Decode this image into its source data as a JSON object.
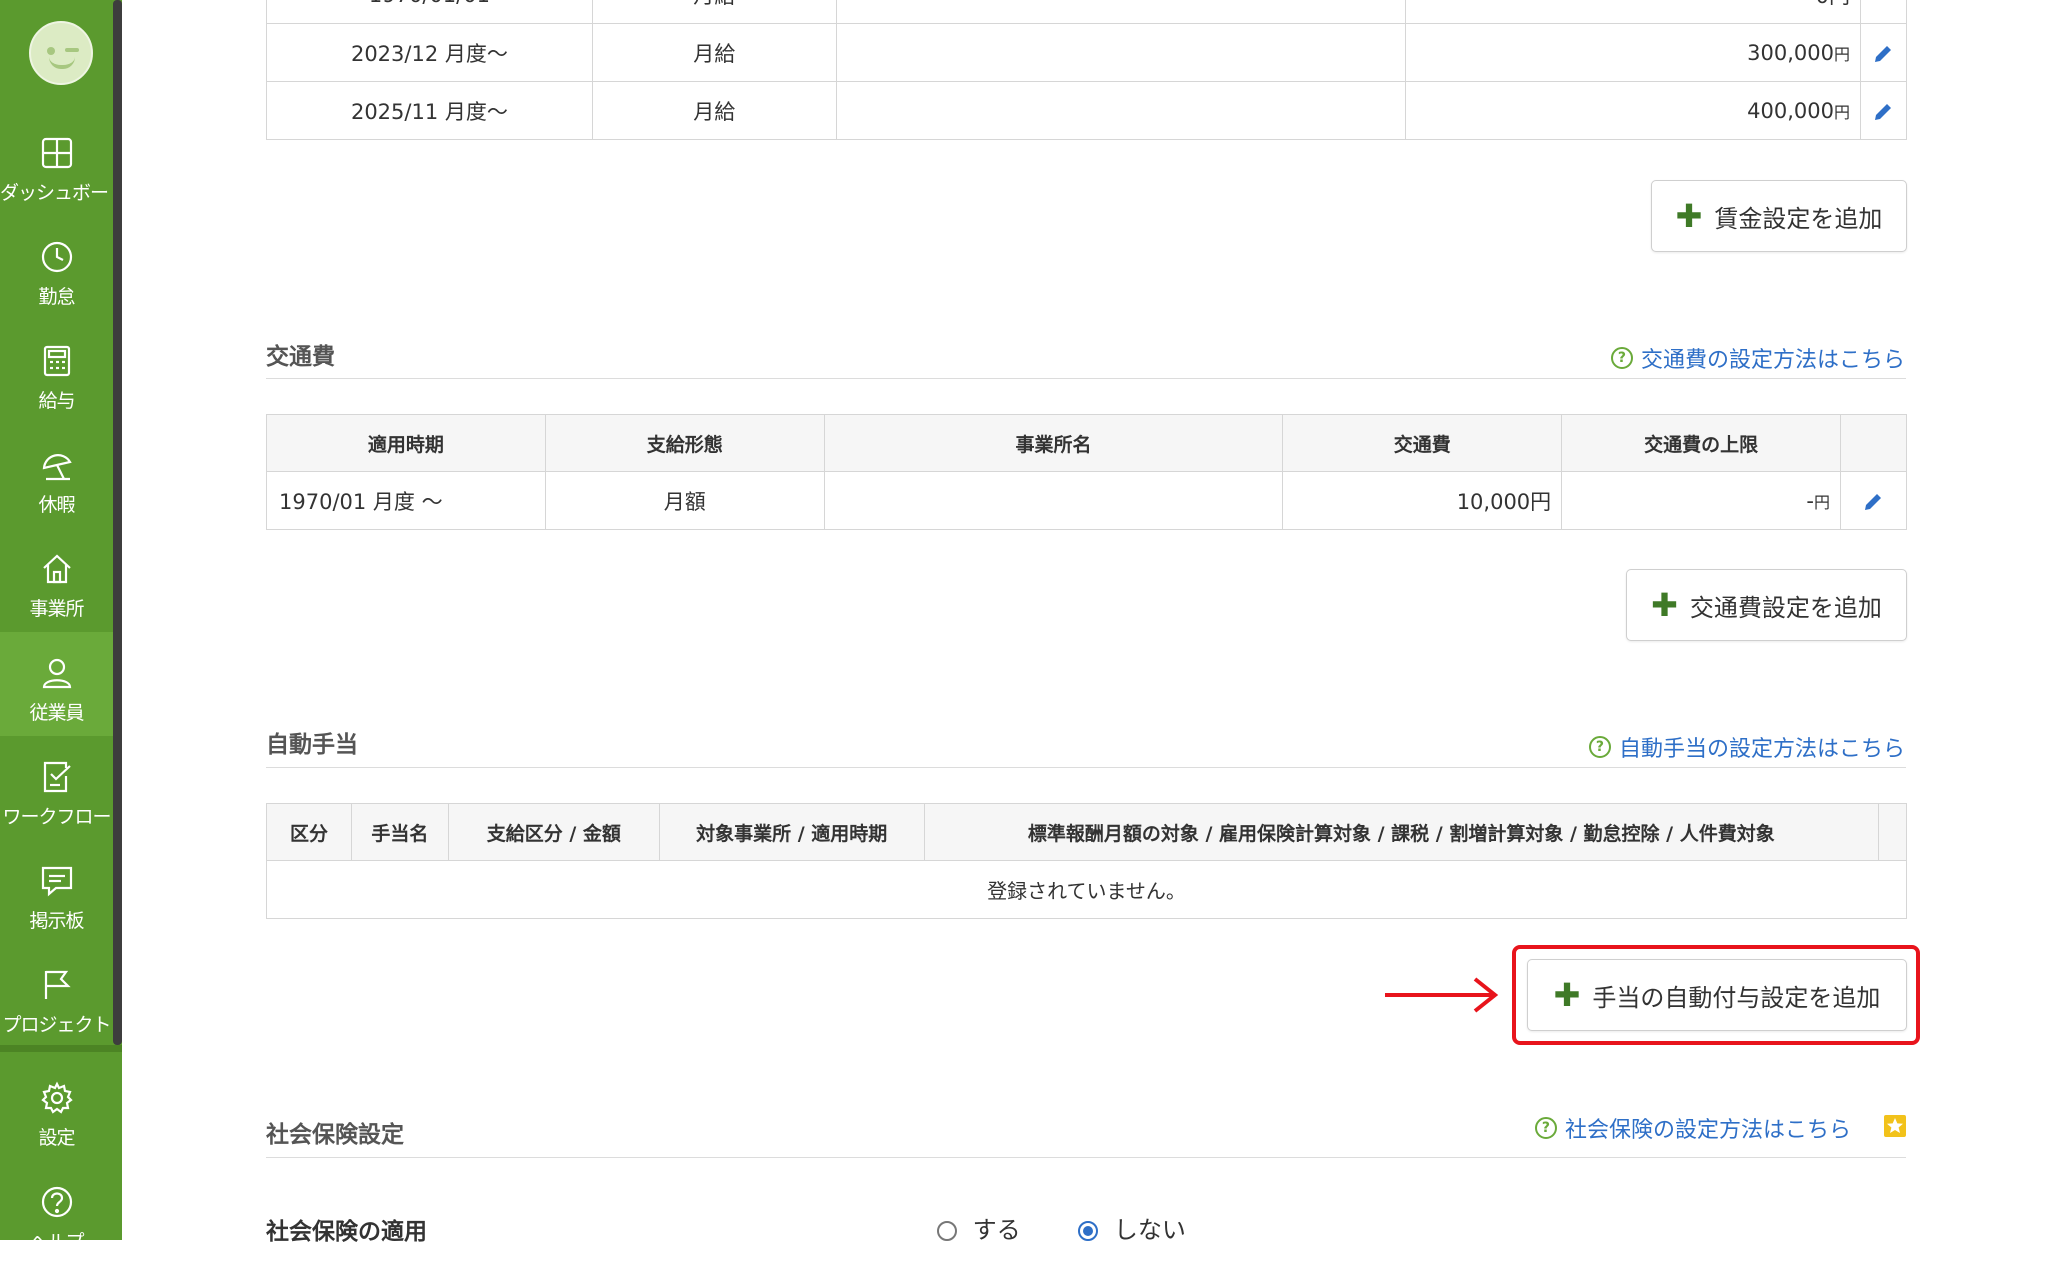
{
  "nav": {
    "items": [
      {
        "label": "ダッシュボード",
        "icon": "dashboard-icon"
      },
      {
        "label": "勤怠",
        "icon": "clock-icon"
      },
      {
        "label": "給与",
        "icon": "calculator-icon"
      },
      {
        "label": "休暇",
        "icon": "umbrella-icon"
      },
      {
        "label": "事業所",
        "icon": "home-icon"
      },
      {
        "label": "従業員",
        "icon": "person-icon"
      },
      {
        "label": "ワークフロー",
        "icon": "checklist-icon"
      },
      {
        "label": "掲示板",
        "icon": "chat-icon"
      },
      {
        "label": "プロジェクト",
        "icon": "flag-icon"
      }
    ],
    "settings_label": "設定",
    "help_label": "ヘルプ"
  },
  "wage": {
    "rows": [
      {
        "period": "2023/12 月度〜",
        "type": "月給",
        "memo": "",
        "amount": "300,000",
        "unit": "円"
      },
      {
        "period": "2025/11 月度〜",
        "type": "月給",
        "memo": "",
        "amount": "400,000",
        "unit": "円"
      }
    ],
    "add_label": "賃金設定を追加"
  },
  "transport": {
    "title": "交通費",
    "help": "交通費の設定方法はこちら",
    "headers": [
      "適用時期",
      "支給形態",
      "事業所名",
      "交通費",
      "交通費の上限"
    ],
    "rows": [
      {
        "period": "1970/01 月度 〜",
        "type": "月額",
        "office": "",
        "amount": "10,000円",
        "limit": "-",
        "limit_unit": "円"
      }
    ],
    "add_label": "交通費設定を追加"
  },
  "allowance": {
    "title": "自動手当",
    "help": "自動手当の設定方法はこちら",
    "headers": [
      "区分",
      "手当名",
      "支給区分 / 金額",
      "対象事業所 / 適用時期",
      "標準報酬月額の対象 / 雇用保険計算対象 / 課税 / 割増計算対象 / 勤怠控除 / 人件費対象"
    ],
    "empty": "登録されていません。",
    "add_label": "手当の自動付与設定を追加"
  },
  "social": {
    "title": "社会保険設定",
    "help": "社会保険の設定方法はこちら",
    "apply_label": "社会保険の適用",
    "option_yes": "する",
    "option_no": "しない",
    "selected": "しない"
  },
  "colors": {
    "sidebar": "#5b9a2e",
    "accent_link": "#2e6fc7",
    "highlight": "#e8141c"
  }
}
